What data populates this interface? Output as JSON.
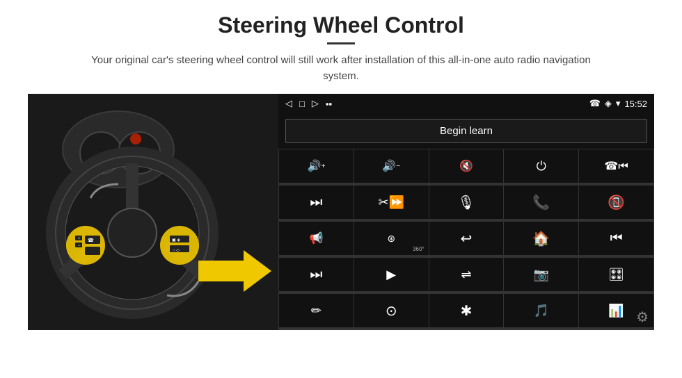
{
  "header": {
    "title": "Steering Wheel Control",
    "divider": true,
    "subtitle": "Your original car's steering wheel control will still work after installation of this all-in-one auto radio navigation system."
  },
  "status_bar": {
    "nav_back": "◁",
    "nav_home": "□",
    "nav_recent": "▷",
    "signal": "▪▪",
    "phone_icon": "☎",
    "location_icon": "◈",
    "wifi_icon": "▾",
    "time": "15:52"
  },
  "begin_learn_button": "Begin learn",
  "icon_rows": [
    [
      {
        "sym": "🔊+",
        "label": "vol-up"
      },
      {
        "sym": "🔊−",
        "label": "vol-down"
      },
      {
        "sym": "🔇",
        "label": "mute"
      },
      {
        "sym": "⏻",
        "label": "power"
      },
      {
        "sym": "⏮",
        "label": "prev-track-phone"
      }
    ],
    [
      {
        "sym": "⏭",
        "label": "next"
      },
      {
        "sym": "⏩",
        "label": "fast-forward"
      },
      {
        "sym": "🎙",
        "label": "mic"
      },
      {
        "sym": "📞",
        "label": "call"
      },
      {
        "sym": "📵",
        "label": "end-call"
      }
    ],
    [
      {
        "sym": "📢",
        "label": "speaker"
      },
      {
        "sym": "🔄",
        "label": "360"
      },
      {
        "sym": "↩",
        "label": "back"
      },
      {
        "sym": "🏠",
        "label": "home"
      },
      {
        "sym": "⏮⏮",
        "label": "rewind"
      }
    ],
    [
      {
        "sym": "⏭⏭",
        "label": "skip"
      },
      {
        "sym": "▶",
        "label": "navigate"
      },
      {
        "sym": "⇌",
        "label": "eq"
      },
      {
        "sym": "📷",
        "label": "camera"
      },
      {
        "sym": "🎛",
        "label": "settings-sliders"
      }
    ],
    [
      {
        "sym": "✏",
        "label": "edit"
      },
      {
        "sym": "⊙",
        "label": "circle-btn"
      },
      {
        "sym": "✱",
        "label": "bluetooth"
      },
      {
        "sym": "🎵",
        "label": "music"
      },
      {
        "sym": "📊",
        "label": "equalizer"
      }
    ]
  ],
  "settings": {
    "gear_label": "settings"
  }
}
